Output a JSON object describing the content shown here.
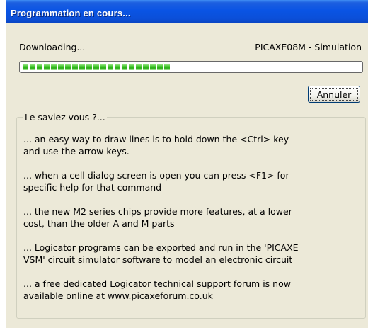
{
  "dialog": {
    "title": "Programmation en cours...",
    "status_text": "Downloading...",
    "device_label": "PICAXE08M - Simulation",
    "progress": {
      "segments_filled": 21,
      "percent": 45
    },
    "cancel_label": "Annuler"
  },
  "tips": {
    "heading": "Le saviez vous ?...",
    "items": [
      "... an easy way to draw lines is to hold down the <Ctrl> key\nand use the arrow keys.",
      "... when a cell dialog screen is open you can press <F1> for\nspecific help for that command",
      "... the new M2 series chips provide more features, at a lower\ncost, than the older A and M parts",
      "... Logicator programs can be exported and run in the 'PICAXE\nVSM' circuit simulator software to model an electronic circuit",
      "... a free dedicated Logicator technical support forum is now\navailable online at www.picaxeforum.co.uk"
    ]
  },
  "colors": {
    "title_bar": "#0a54e4",
    "dialog_bg": "#ece9d8",
    "progress_green": "#2cae18"
  }
}
